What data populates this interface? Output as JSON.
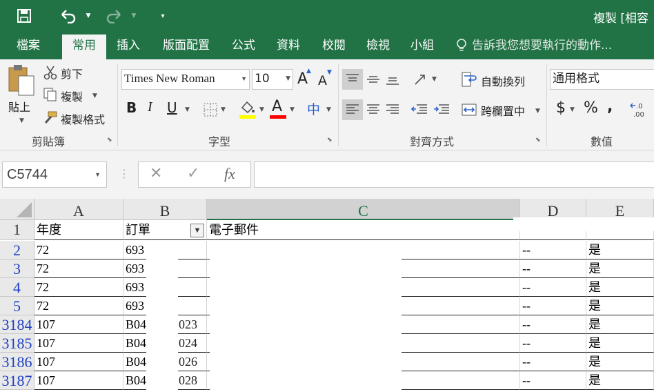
{
  "title_bar": {
    "title": "複製  [相容",
    "icons": [
      "save-icon",
      "undo-icon",
      "redo-icon",
      "customize-quick-access-icon"
    ]
  },
  "tabs": [
    {
      "label": "檔案"
    },
    {
      "label": "常用",
      "active": true
    },
    {
      "label": "插入"
    },
    {
      "label": "版面配置"
    },
    {
      "label": "公式"
    },
    {
      "label": "資料"
    },
    {
      "label": "校閱"
    },
    {
      "label": "檢視"
    },
    {
      "label": "小組"
    }
  ],
  "tell_me": "告訴我您想要執行的動作...",
  "ribbon": {
    "clipboard": {
      "paste": "貼上",
      "cut": "剪下",
      "copy": "複製",
      "format_painter": "複製格式",
      "group": "剪貼簿"
    },
    "font": {
      "name": "Times New Roman",
      "size": "10",
      "bold": "B",
      "italic": "I",
      "underline": "U",
      "grow": "A",
      "shrink": "A",
      "font_color_letter": "A",
      "phonetic": "中",
      "group": "字型",
      "fill_color": "#ffff00",
      "text_color": "#ff0000"
    },
    "alignment": {
      "wrap_text": "自動換列",
      "merge_center": "跨欄置中",
      "group": "對齊方式"
    },
    "number": {
      "format": "通用格式",
      "currency": "$",
      "percent": "%",
      "comma": ",",
      "group": "數值"
    }
  },
  "formula_bar": {
    "name_box": "C5744",
    "cancel": "✕",
    "enter": "✓",
    "fx": "fx",
    "value": ""
  },
  "sheet": {
    "columns": [
      "A",
      "B",
      "C",
      "D",
      "E"
    ],
    "selected_column": "C",
    "header_row": {
      "row": "1",
      "a": "年度",
      "b": "訂單",
      "c": "電子郵件",
      "d": "",
      "e": ""
    },
    "rows": [
      {
        "row": "2",
        "a": "72",
        "b": "693",
        "c": "",
        "d": "--",
        "e": "是"
      },
      {
        "row": "3",
        "a": "72",
        "b": "693",
        "c": "",
        "d": "--",
        "e": "是"
      },
      {
        "row": "4",
        "a": "72",
        "b": "693",
        "c": "",
        "d": "--",
        "e": "是"
      },
      {
        "row": "5",
        "a": "72",
        "b": "693",
        "c": "",
        "d": "--",
        "e": "是"
      },
      {
        "row": "3184",
        "a": "107",
        "b": "B04",
        "b2": "023",
        "c": "",
        "d": "--",
        "e": "是"
      },
      {
        "row": "3185",
        "a": "107",
        "b": "B04",
        "b2": "024",
        "c": "",
        "d": "--",
        "e": "是"
      },
      {
        "row": "3186",
        "a": "107",
        "b": "B04",
        "b2": "026",
        "c": "",
        "d": "--",
        "e": "是"
      },
      {
        "row": "3187",
        "a": "107",
        "b": "B04",
        "b2": "028",
        "c": "",
        "d": "--",
        "e": "是"
      }
    ]
  }
}
